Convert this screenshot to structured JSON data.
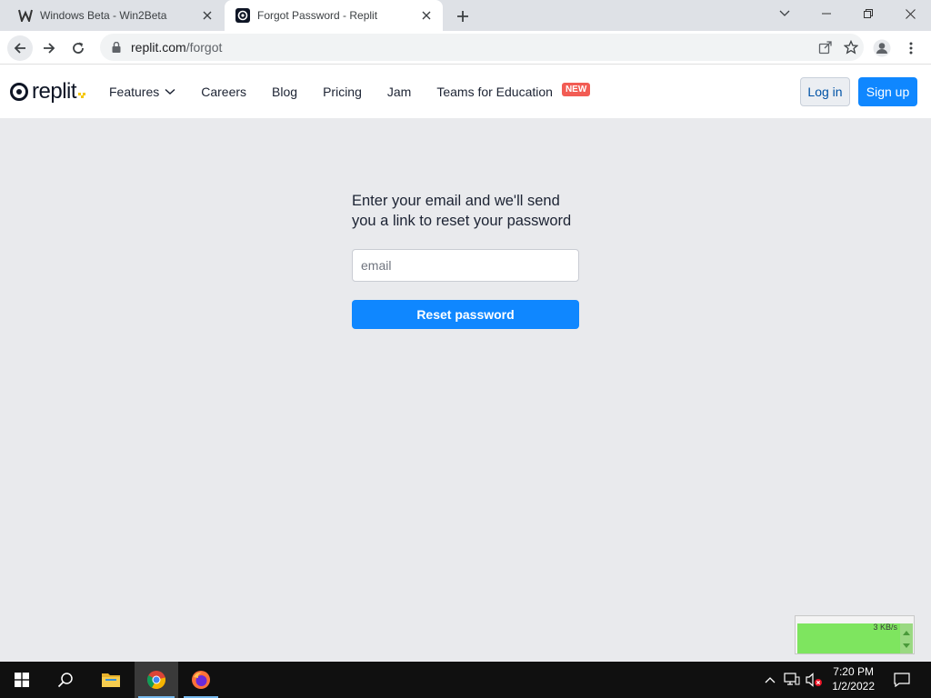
{
  "browser": {
    "tabs": [
      {
        "title": "Windows Beta - Win2Beta",
        "active": false,
        "favicon": "win2beta-w-icon"
      },
      {
        "title": "Forgot Password - Replit",
        "active": true,
        "favicon": "replit-icon"
      }
    ],
    "url_host": "replit.com",
    "url_path": "/forgot"
  },
  "site": {
    "logo_text": "replit",
    "nav": [
      {
        "label": "Features",
        "has_dropdown": true
      },
      {
        "label": "Careers"
      },
      {
        "label": "Blog"
      },
      {
        "label": "Pricing"
      },
      {
        "label": "Jam"
      },
      {
        "label": "Teams for Education"
      }
    ],
    "new_badge": "NEW",
    "login_label": "Log in",
    "signup_label": "Sign up"
  },
  "form": {
    "prompt": "Enter your email and we'll send you a link to reset your password",
    "email_placeholder": "email",
    "email_value": "",
    "submit_label": "Reset password"
  },
  "netmeter": {
    "rate": "3 KB/s"
  },
  "taskbar": {
    "time": "7:20 PM",
    "date": "1/2/2022",
    "pinned": [
      "windows-start",
      "search",
      "file-explorer",
      "chrome",
      "firefox"
    ]
  },
  "colors": {
    "accent_blue": "#0f87ff",
    "badge_red": "#f25c54",
    "page_bg": "#e9eaed"
  }
}
